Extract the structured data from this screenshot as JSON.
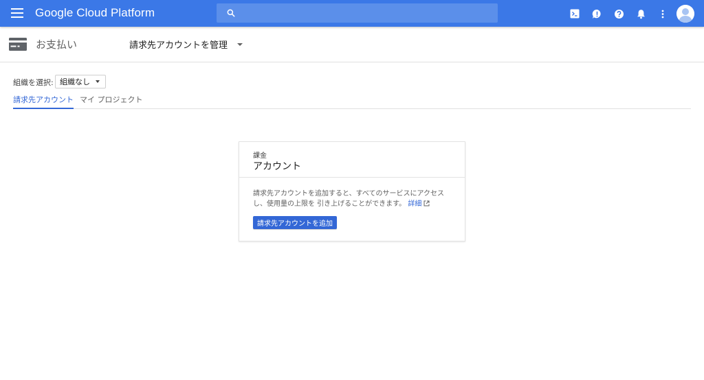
{
  "appbar": {
    "brand": "Google Cloud Platform",
    "search_placeholder": "",
    "icons": [
      "menu-icon",
      "search-icon",
      "cloud-shell-icon",
      "feedback-icon",
      "help-icon",
      "notifications-icon",
      "more-vert-icon",
      "account-avatar"
    ]
  },
  "subheader": {
    "section_title": "お支払い",
    "manage_label": "請求先アカウントを管理"
  },
  "org": {
    "label": "組織を選択:",
    "selected": "組織なし"
  },
  "tabs": [
    {
      "label": "請求先アカウント",
      "active": true
    },
    {
      "label": "マイ プロジェクト",
      "active": false
    }
  ],
  "card": {
    "overline": "課金",
    "title": "アカウント",
    "description": "請求先アカウントを追加すると、すべてのサービスにアクセスし、使用量の上限を 引き上げることができます。",
    "link_text": "詳細",
    "button_label": "請求先アカウントを追加"
  },
  "colors": {
    "appbar": "#3b78e7",
    "accent": "#3367d6"
  }
}
